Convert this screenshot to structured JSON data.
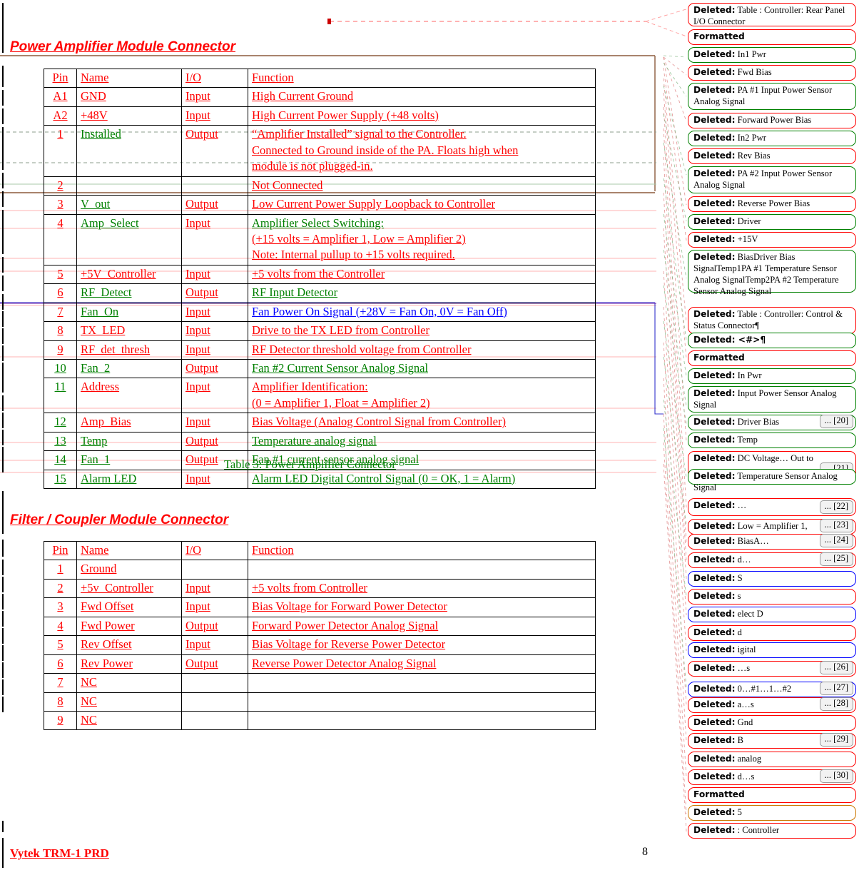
{
  "document": {
    "footer_left": "Vytek TRM-1 PRD",
    "page_number": "8"
  },
  "sections": [
    {
      "heading": "Power Amplifier Module Connector",
      "caption": "Table 3:  Power Amplifier Connector",
      "columns": [
        "Pin",
        "Name",
        "I/O",
        "Function"
      ],
      "rows": [
        {
          "pin": "A1",
          "name": "GND",
          "io": "Input",
          "func": [
            "High Current Ground"
          ]
        },
        {
          "pin": "A2",
          "name": "+48V",
          "io": "Input",
          "func": [
            "High Current Power Supply  (+48 volts)"
          ]
        },
        {
          "pin": "1",
          "name": "Installed",
          "io": "Output",
          "func": [
            "“Amplifier Installed” signal to the Controller.",
            "Connected to Ground inside of the PA.  Floats high when",
            "module is not plugged-in."
          ]
        },
        {
          "pin": "2",
          "name": "",
          "io": "",
          "func": [
            "Not Connected"
          ]
        },
        {
          "pin": "3",
          "name": "V_out",
          "io": "Output",
          "func": [
            "Low Current Power Supply Loopback to Controller"
          ]
        },
        {
          "pin": "4",
          "name": "Amp_Select",
          "io": "Input",
          "func": [
            "Amplifier Select Switching:",
            "(+15 volts = Amplifier 1, Low = Amplifier 2)",
            "Note:  Internal pullup to +15 volts required."
          ]
        },
        {
          "pin": "5",
          "name": "+5V_Controller",
          "io": "Input",
          "func": [
            "+5 volts from the Controller"
          ]
        },
        {
          "pin": "6",
          "name": "RF_Detect",
          "io": "Output",
          "func": [
            "RF Input Detector"
          ]
        },
        {
          "pin": "7",
          "name": "Fan_On",
          "io": "Input",
          "func": [
            "Fan Power On Signal (+28V = Fan On, 0V = Fan Off)"
          ]
        },
        {
          "pin": "8",
          "name": "TX_LED",
          "io": "Input",
          "func": [
            "Drive to the TX LED from Controller"
          ]
        },
        {
          "pin": "9",
          "name": "RF_det_thresh",
          "io": "Input",
          "func": [
            "RF Detector threshold voltage from Controller"
          ]
        },
        {
          "pin": "10",
          "name": "Fan_2",
          "io": "Output",
          "func": [
            "Fan #2 Current Sensor Analog Signal"
          ]
        },
        {
          "pin": "11",
          "name": "Address",
          "io": "Input",
          "func": [
            "Amplifier Identification:",
            "(0 = Amplifier 1, Float = Amplifier 2)"
          ]
        },
        {
          "pin": "12",
          "name": "Amp_Bias",
          "io": "Input",
          "func": [
            "Bias Voltage (Analog Control Signal from Controller)"
          ]
        },
        {
          "pin": "13",
          "name": "Temp",
          "io": "Output",
          "func": [
            "Temperature analog signal"
          ]
        },
        {
          "pin": "14",
          "name": "Fan_1",
          "io": "Output",
          "func": [
            "Fan #1 current sensor analog signal"
          ]
        },
        {
          "pin": "15",
          "name": "Alarm LED",
          "io": "Input",
          "func": [
            "Alarm LED Digital Control Signal (0 = OK, 1 = Alarm)"
          ]
        }
      ]
    },
    {
      "heading": "Filter / Coupler Module Connector",
      "caption": "",
      "columns": [
        "Pin",
        "Name",
        "I/O",
        "Function"
      ],
      "rows": [
        {
          "pin": "1",
          "name": "Ground",
          "io": "",
          "func": [
            ""
          ]
        },
        {
          "pin": "2",
          "name": "+5v_Controller",
          "io": "Input",
          "func": [
            "+5 volts from Controller"
          ]
        },
        {
          "pin": "3",
          "name": "Fwd Offset",
          "io": "Input",
          "func": [
            "Bias Voltage for Forward Power Detector"
          ]
        },
        {
          "pin": "4",
          "name": "Fwd Power",
          "io": "Output",
          "func": [
            "Forward Power Detector Analog Signal"
          ]
        },
        {
          "pin": "5",
          "name": "Rev Offset",
          "io": "Input",
          "func": [
            "Bias Voltage for Reverse Power Detector"
          ]
        },
        {
          "pin": "6",
          "name": "Rev Power",
          "io": "Output",
          "func": [
            "Reverse Power Detector Analog Signal"
          ]
        },
        {
          "pin": "7",
          "name": "NC",
          "io": "",
          "func": [
            ""
          ]
        },
        {
          "pin": "8",
          "name": "NC",
          "io": "",
          "func": [
            ""
          ]
        },
        {
          "pin": "9",
          "name": "NC",
          "io": "",
          "func": [
            ""
          ]
        }
      ]
    }
  ],
  "margin_comments": [
    {
      "label": "Deleted:",
      "text": "Table : Controller:  Rear Panel I/O Connector",
      "color": "#ff0000",
      "overflow": ""
    },
    {
      "label": "Formatted",
      "text": "",
      "color": "#ff0000",
      "overflow": ""
    },
    {
      "label": "Deleted:",
      "text": "In1 Pwr",
      "color": "#008000",
      "overflow": ""
    },
    {
      "label": "Deleted:",
      "text": "Fwd Bias",
      "color": "#ff0000",
      "overflow": ""
    },
    {
      "label": "Deleted:",
      "text": "PA #1 Input Power Sensor Analog Signal",
      "color": "#008000",
      "overflow": ""
    },
    {
      "label": "Deleted:",
      "text": "Forward Power Bias",
      "color": "#ff0000",
      "overflow": ""
    },
    {
      "label": "Deleted:",
      "text": "In2 Pwr",
      "color": "#008000",
      "overflow": ""
    },
    {
      "label": "Deleted:",
      "text": "Rev Bias",
      "color": "#ff0000",
      "overflow": ""
    },
    {
      "label": "Deleted:",
      "text": "PA #2 Input Power Sensor Analog Signal",
      "color": "#008000",
      "overflow": ""
    },
    {
      "label": "Deleted:",
      "text": "Reverse Power Bias",
      "color": "#ff0000",
      "overflow": ""
    },
    {
      "label": "Deleted:",
      "text": "Driver",
      "color": "#008000",
      "overflow": ""
    },
    {
      "label": "Deleted:",
      "text": "+15V",
      "color": "#ff0000",
      "overflow": ""
    },
    {
      "label": "Deleted:",
      "text": " BiasDriver Bias SignalTemp1PA #1 Temperature Sensor Analog SignalTemp2PA #2 Temperature Sensor Analog Signal",
      "color": "#008000",
      "overflow": ""
    },
    {
      "label": "Deleted:",
      "text": "Table : Controller:  Control & Status Connector¶",
      "color": "#ff0000",
      "overflow": ""
    },
    {
      "label": "Deleted: <#>¶",
      "text": "",
      "color": "#008000",
      "overflow": ""
    },
    {
      "label": "Formatted",
      "text": "",
      "color": "#ff0000",
      "overflow": ""
    },
    {
      "label": "Deleted:",
      "text": "In Pwr",
      "color": "#008000",
      "overflow": ""
    },
    {
      "label": "Deleted:",
      "text": "Input Power Sensor Analog Signal",
      "color": "#008000",
      "overflow": ""
    },
    {
      "label": "Deleted:",
      "text": "Driver Bias",
      "color": "#008000",
      "overflow": "... [20]"
    },
    {
      "label": "Deleted:",
      "text": "Temp",
      "color": "#008000",
      "overflow": ""
    },
    {
      "label": "Deleted:",
      "text": "DC Voltage… Out to",
      "color": "#ff0000",
      "overflow": "... [21]"
    },
    {
      "label": "Deleted:",
      "text": "Temperature Sensor Analog Signal",
      "color": "#008000",
      "overflow": ""
    },
    {
      "label": "Deleted:",
      "text": " …",
      "color": "#ff0000",
      "overflow": "... [22]"
    },
    {
      "label": "Deleted:",
      "text": "Low = Amplifier 1,",
      "color": "#ff0000",
      "overflow": "... [23]"
    },
    {
      "label": "Deleted:",
      "text": "BiasA…",
      "color": "#ff0000",
      "overflow": "... [24]"
    },
    {
      "label": "Deleted:",
      "text": "d…",
      "color": "#ff0000",
      "overflow": "... [25]"
    },
    {
      "label": "Deleted:",
      "text": "S",
      "color": "#0000ff",
      "overflow": ""
    },
    {
      "label": "Deleted:",
      "text": "s",
      "color": "#ff0000",
      "overflow": ""
    },
    {
      "label": "Deleted:",
      "text": "elect D",
      "color": "#0000ff",
      "overflow": ""
    },
    {
      "label": "Deleted:",
      "text": "d",
      "color": "#ff0000",
      "overflow": ""
    },
    {
      "label": "Deleted:",
      "text": "igital",
      "color": "#0000ff",
      "overflow": ""
    },
    {
      "label": "Deleted:",
      "text": " …s",
      "color": "#ff0000",
      "overflow": "... [26]"
    },
    {
      "label": "Deleted:",
      "text": "0…#1…1…#2",
      "color": "#0000ff",
      "overflow": "... [27]"
    },
    {
      "label": "Deleted:",
      "text": "a…s",
      "color": "#ff0000",
      "overflow": "... [28]"
    },
    {
      "label": "Deleted:",
      "text": "Gnd",
      "color": "#ff0000",
      "overflow": ""
    },
    {
      "label": "Deleted:",
      "text": "B",
      "color": "#ff0000",
      "overflow": "... [29]"
    },
    {
      "label": "Deleted:",
      "text": "analog",
      "color": "#ff0000",
      "overflow": ""
    },
    {
      "label": "Deleted:",
      "text": "d…s",
      "color": "#ff0000",
      "overflow": "... [30]"
    },
    {
      "label": "Formatted",
      "text": "",
      "color": "#ff0000",
      "overflow": ""
    },
    {
      "label": "Deleted:",
      "text": "5",
      "color": "#cc7700",
      "overflow": ""
    },
    {
      "label": "Deleted:",
      "text": ":  Controller",
      "color": "#ff0000",
      "overflow": ""
    }
  ]
}
